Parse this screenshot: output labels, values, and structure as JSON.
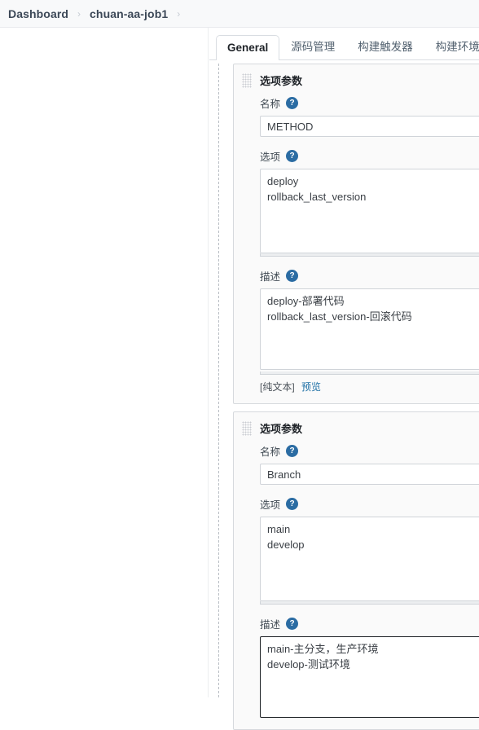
{
  "breadcrumb": {
    "items": [
      {
        "label": "Dashboard"
      },
      {
        "label": "chuan-aa-job1"
      }
    ],
    "separator": "›"
  },
  "tabs": [
    {
      "label": "General",
      "active": true
    },
    {
      "label": "源码管理",
      "active": false
    },
    {
      "label": "构建触发器",
      "active": false
    },
    {
      "label": "构建环境",
      "active": false
    }
  ],
  "labels": {
    "name": "名称",
    "choices": "选项",
    "description": "描述",
    "help_icon": "?",
    "markup_type": "[纯文本]",
    "preview_link": "预览"
  },
  "colors": {
    "accent": "#1d6fa5",
    "help_icon_bg": "#2b6ca3",
    "panel_bg": "#fafafa",
    "panel_border": "#d6d9dd",
    "focus_border": "#1b1f23"
  },
  "parameter_blocks": [
    {
      "title": "选项参数",
      "name_value": "METHOD",
      "choices_value": "deploy\nrollback_last_version",
      "description_value": "deploy-部署代码\nrollback_last_version-回滚代码",
      "description_focused": false,
      "has_markup_row": true
    },
    {
      "title": "选项参数",
      "name_value": "Branch",
      "choices_value": "main\ndevelop",
      "description_value": "main-主分支，生产环境\ndevelop-测试环境",
      "description_focused": true,
      "has_markup_row": false
    }
  ]
}
